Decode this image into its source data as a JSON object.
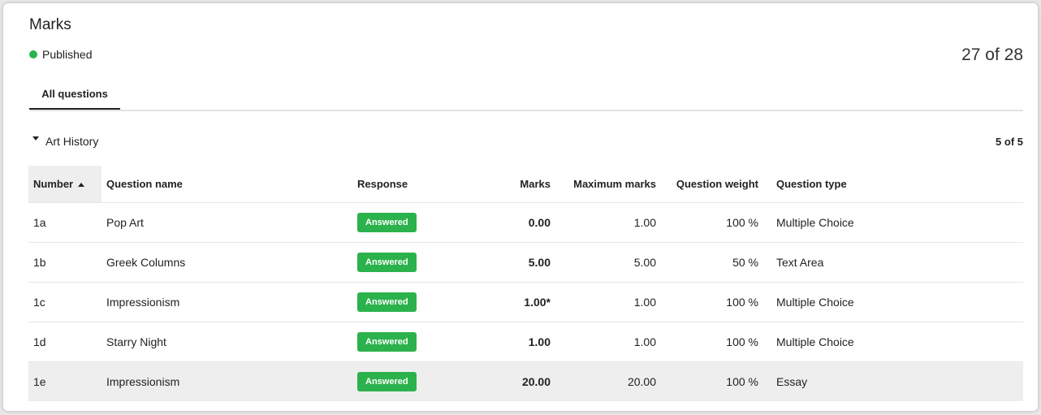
{
  "header": {
    "title": "Marks",
    "status": "Published",
    "counter": "27 of 28"
  },
  "tabs": [
    {
      "label": "All questions"
    }
  ],
  "section": {
    "name": "Art History",
    "count": "5 of 5"
  },
  "table": {
    "headers": [
      "Number",
      "Question name",
      "Response",
      "Marks",
      "Maximum marks",
      "Question weight",
      "Question type"
    ],
    "rows": [
      {
        "number": "1a",
        "name": "Pop Art",
        "response": "Answered",
        "marks": "0.00",
        "max": "1.00",
        "weight": "100 %",
        "type": "Multiple Choice"
      },
      {
        "number": "1b",
        "name": "Greek Columns",
        "response": "Answered",
        "marks": "5.00",
        "max": "5.00",
        "weight": "50 %",
        "type": "Text Area"
      },
      {
        "number": "1c",
        "name": "Impressionism",
        "response": "Answered",
        "marks": "1.00*",
        "max": "1.00",
        "weight": "100 %",
        "type": "Multiple Choice"
      },
      {
        "number": "1d",
        "name": "Starry Night",
        "response": "Answered",
        "marks": "1.00",
        "max": "1.00",
        "weight": "100 %",
        "type": "Multiple Choice"
      },
      {
        "number": "1e",
        "name": "Impressionism",
        "response": "Answered",
        "marks": "20.00",
        "max": "20.00",
        "weight": "100 %",
        "type": "Essay"
      }
    ]
  },
  "colors": {
    "status_green": "#2bb24c",
    "highlight_row": "#eeeeee"
  }
}
